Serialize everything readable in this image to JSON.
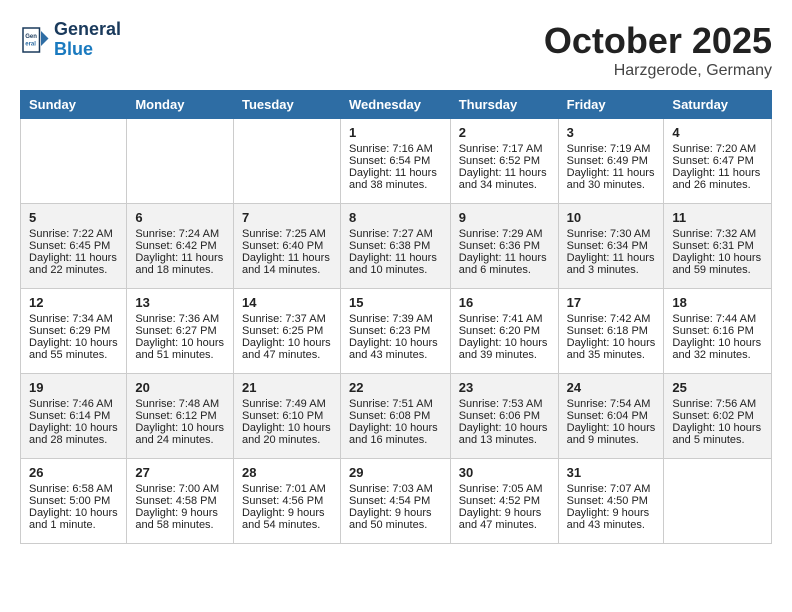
{
  "header": {
    "logo_line1": "General",
    "logo_line2": "Blue",
    "month": "October 2025",
    "location": "Harzgerode, Germany"
  },
  "weekdays": [
    "Sunday",
    "Monday",
    "Tuesday",
    "Wednesday",
    "Thursday",
    "Friday",
    "Saturday"
  ],
  "weeks": [
    [
      {
        "day": "",
        "info": ""
      },
      {
        "day": "",
        "info": ""
      },
      {
        "day": "",
        "info": ""
      },
      {
        "day": "1",
        "info": "Sunrise: 7:16 AM\nSunset: 6:54 PM\nDaylight: 11 hours\nand 38 minutes."
      },
      {
        "day": "2",
        "info": "Sunrise: 7:17 AM\nSunset: 6:52 PM\nDaylight: 11 hours\nand 34 minutes."
      },
      {
        "day": "3",
        "info": "Sunrise: 7:19 AM\nSunset: 6:49 PM\nDaylight: 11 hours\nand 30 minutes."
      },
      {
        "day": "4",
        "info": "Sunrise: 7:20 AM\nSunset: 6:47 PM\nDaylight: 11 hours\nand 26 minutes."
      }
    ],
    [
      {
        "day": "5",
        "info": "Sunrise: 7:22 AM\nSunset: 6:45 PM\nDaylight: 11 hours\nand 22 minutes."
      },
      {
        "day": "6",
        "info": "Sunrise: 7:24 AM\nSunset: 6:42 PM\nDaylight: 11 hours\nand 18 minutes."
      },
      {
        "day": "7",
        "info": "Sunrise: 7:25 AM\nSunset: 6:40 PM\nDaylight: 11 hours\nand 14 minutes."
      },
      {
        "day": "8",
        "info": "Sunrise: 7:27 AM\nSunset: 6:38 PM\nDaylight: 11 hours\nand 10 minutes."
      },
      {
        "day": "9",
        "info": "Sunrise: 7:29 AM\nSunset: 6:36 PM\nDaylight: 11 hours\nand 6 minutes."
      },
      {
        "day": "10",
        "info": "Sunrise: 7:30 AM\nSunset: 6:34 PM\nDaylight: 11 hours\nand 3 minutes."
      },
      {
        "day": "11",
        "info": "Sunrise: 7:32 AM\nSunset: 6:31 PM\nDaylight: 10 hours\nand 59 minutes."
      }
    ],
    [
      {
        "day": "12",
        "info": "Sunrise: 7:34 AM\nSunset: 6:29 PM\nDaylight: 10 hours\nand 55 minutes."
      },
      {
        "day": "13",
        "info": "Sunrise: 7:36 AM\nSunset: 6:27 PM\nDaylight: 10 hours\nand 51 minutes."
      },
      {
        "day": "14",
        "info": "Sunrise: 7:37 AM\nSunset: 6:25 PM\nDaylight: 10 hours\nand 47 minutes."
      },
      {
        "day": "15",
        "info": "Sunrise: 7:39 AM\nSunset: 6:23 PM\nDaylight: 10 hours\nand 43 minutes."
      },
      {
        "day": "16",
        "info": "Sunrise: 7:41 AM\nSunset: 6:20 PM\nDaylight: 10 hours\nand 39 minutes."
      },
      {
        "day": "17",
        "info": "Sunrise: 7:42 AM\nSunset: 6:18 PM\nDaylight: 10 hours\nand 35 minutes."
      },
      {
        "day": "18",
        "info": "Sunrise: 7:44 AM\nSunset: 6:16 PM\nDaylight: 10 hours\nand 32 minutes."
      }
    ],
    [
      {
        "day": "19",
        "info": "Sunrise: 7:46 AM\nSunset: 6:14 PM\nDaylight: 10 hours\nand 28 minutes."
      },
      {
        "day": "20",
        "info": "Sunrise: 7:48 AM\nSunset: 6:12 PM\nDaylight: 10 hours\nand 24 minutes."
      },
      {
        "day": "21",
        "info": "Sunrise: 7:49 AM\nSunset: 6:10 PM\nDaylight: 10 hours\nand 20 minutes."
      },
      {
        "day": "22",
        "info": "Sunrise: 7:51 AM\nSunset: 6:08 PM\nDaylight: 10 hours\nand 16 minutes."
      },
      {
        "day": "23",
        "info": "Sunrise: 7:53 AM\nSunset: 6:06 PM\nDaylight: 10 hours\nand 13 minutes."
      },
      {
        "day": "24",
        "info": "Sunrise: 7:54 AM\nSunset: 6:04 PM\nDaylight: 10 hours\nand 9 minutes."
      },
      {
        "day": "25",
        "info": "Sunrise: 7:56 AM\nSunset: 6:02 PM\nDaylight: 10 hours\nand 5 minutes."
      }
    ],
    [
      {
        "day": "26",
        "info": "Sunrise: 6:58 AM\nSunset: 5:00 PM\nDaylight: 10 hours\nand 1 minute."
      },
      {
        "day": "27",
        "info": "Sunrise: 7:00 AM\nSunset: 4:58 PM\nDaylight: 9 hours\nand 58 minutes."
      },
      {
        "day": "28",
        "info": "Sunrise: 7:01 AM\nSunset: 4:56 PM\nDaylight: 9 hours\nand 54 minutes."
      },
      {
        "day": "29",
        "info": "Sunrise: 7:03 AM\nSunset: 4:54 PM\nDaylight: 9 hours\nand 50 minutes."
      },
      {
        "day": "30",
        "info": "Sunrise: 7:05 AM\nSunset: 4:52 PM\nDaylight: 9 hours\nand 47 minutes."
      },
      {
        "day": "31",
        "info": "Sunrise: 7:07 AM\nSunset: 4:50 PM\nDaylight: 9 hours\nand 43 minutes."
      },
      {
        "day": "",
        "info": ""
      }
    ]
  ]
}
